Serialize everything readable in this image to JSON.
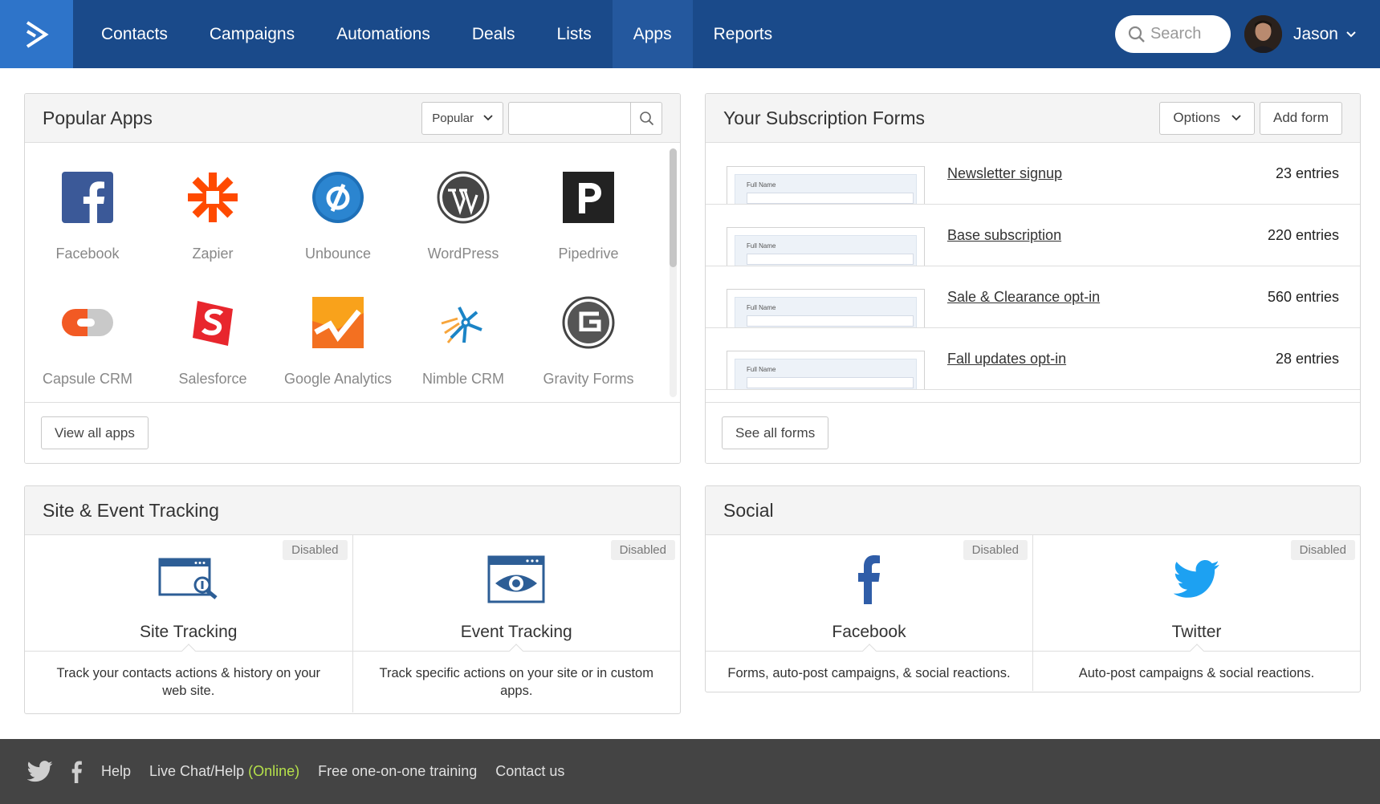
{
  "nav": {
    "links": [
      "Contacts",
      "Campaigns",
      "Automations",
      "Deals",
      "Lists",
      "Apps",
      "Reports"
    ],
    "active": "Apps",
    "search_placeholder": "Search",
    "user_name": "Jason"
  },
  "popular_apps": {
    "title": "Popular Apps",
    "filter_label": "Popular",
    "apps": [
      "Facebook",
      "Zapier",
      "Unbounce",
      "WordPress",
      "Pipedrive",
      "Capsule CRM",
      "Salesforce",
      "Google Analytics",
      "Nimble CRM",
      "Gravity Forms"
    ],
    "view_all_label": "View all apps"
  },
  "subscription_forms": {
    "title": "Your Subscription Forms",
    "options_label": "Options",
    "add_form_label": "Add form",
    "thumb_label": "Full Name",
    "forms": [
      {
        "name": "Newsletter signup",
        "entries": "23 entries"
      },
      {
        "name": "Base subscription",
        "entries": "220 entries"
      },
      {
        "name": "Sale & Clearance opt-in",
        "entries": "560 entries"
      },
      {
        "name": "Fall updates opt-in",
        "entries": "28 entries"
      }
    ],
    "see_all_label": "See all forms"
  },
  "tracking": {
    "title": "Site & Event Tracking",
    "cards": [
      {
        "badge": "Disabled",
        "title": "Site Tracking",
        "desc": "Track your contacts actions & history on your web site."
      },
      {
        "badge": "Disabled",
        "title": "Event Tracking",
        "desc": "Track specific actions on your site or in custom apps."
      }
    ]
  },
  "social": {
    "title": "Social",
    "cards": [
      {
        "badge": "Disabled",
        "title": "Facebook",
        "desc": "Forms, auto-post campaigns, & social reactions."
      },
      {
        "badge": "Disabled",
        "title": "Twitter",
        "desc": "Auto-post campaigns & social reactions."
      }
    ]
  },
  "footer": {
    "help": "Help",
    "live_chat": "Live Chat/Help",
    "online": "(Online)",
    "training": "Free one-on-one training",
    "contact": "Contact us"
  },
  "colors": {
    "nav_bg": "#1a4a8a",
    "logo_bg": "#2e74c9",
    "footer_bg": "#444444",
    "online_green": "#b5e04a",
    "facebook_blue": "#3b5998",
    "twitter_blue": "#1da1f2"
  }
}
